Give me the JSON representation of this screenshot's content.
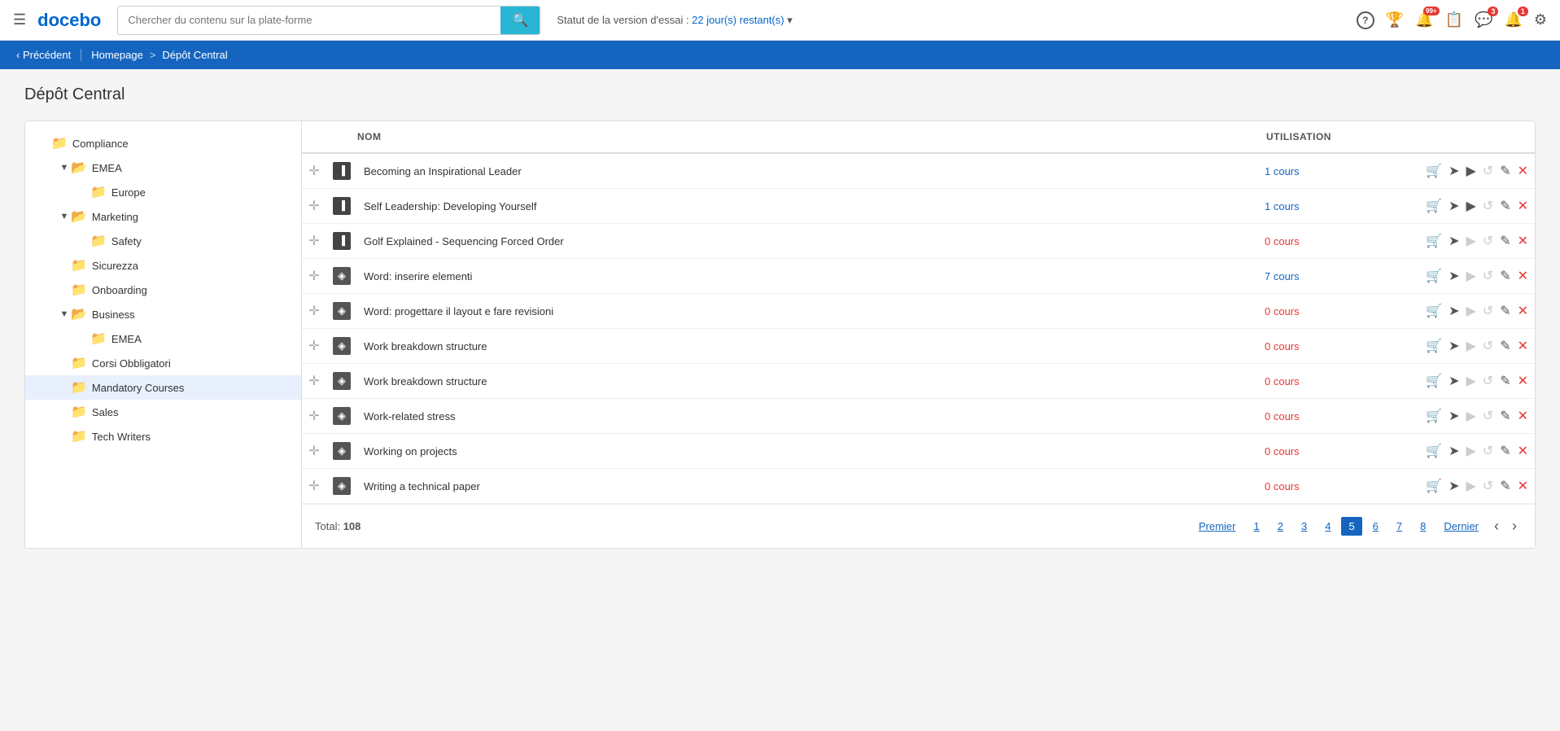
{
  "app": {
    "logo": "docebo",
    "hamburger_label": "☰"
  },
  "search": {
    "placeholder": "Chercher du contenu sur la plate-forme",
    "icon": "🔍"
  },
  "trial": {
    "label": "Statut de la version d'essai : ",
    "days": "22 jour(s) restant(s)",
    "arrow": "▾"
  },
  "nav_icons": [
    {
      "name": "help-icon",
      "symbol": "?",
      "badge": null
    },
    {
      "name": "trophy-icon",
      "symbol": "🏆",
      "badge": null
    },
    {
      "name": "notification-icon",
      "symbol": "🔔",
      "badge": "99+"
    },
    {
      "name": "tasks-icon",
      "symbol": "📋",
      "badge": null
    },
    {
      "name": "chat-icon",
      "symbol": "💬",
      "badge": "3"
    },
    {
      "name": "alerts-icon",
      "symbol": "🔔",
      "badge": "1"
    },
    {
      "name": "settings-icon",
      "symbol": "⚙",
      "badge": null
    }
  ],
  "breadcrumb": {
    "back_label": "‹ Précédent",
    "home": "Homepage",
    "separator": ">",
    "current": "Dépôt Central"
  },
  "page": {
    "title": "Dépôt Central"
  },
  "sidebar": {
    "items": [
      {
        "id": "compliance",
        "label": "Compliance",
        "indent": 1,
        "type": "folder",
        "toggle": "",
        "expanded": false
      },
      {
        "id": "emea",
        "label": "EMEA",
        "indent": 2,
        "type": "folder",
        "toggle": "▼",
        "expanded": true
      },
      {
        "id": "europe",
        "label": "Europe",
        "indent": 3,
        "type": "folder",
        "toggle": "",
        "expanded": false
      },
      {
        "id": "marketing",
        "label": "Marketing",
        "indent": 2,
        "type": "folder",
        "toggle": "▼",
        "expanded": true
      },
      {
        "id": "safety",
        "label": "Safety",
        "indent": 3,
        "type": "folder",
        "toggle": "",
        "expanded": false
      },
      {
        "id": "sicurezza",
        "label": "Sicurezza",
        "indent": 2,
        "type": "folder",
        "toggle": "",
        "expanded": false
      },
      {
        "id": "onboarding",
        "label": "Onboarding",
        "indent": 2,
        "type": "folder",
        "toggle": "",
        "expanded": false
      },
      {
        "id": "business",
        "label": "Business",
        "indent": 2,
        "type": "folder",
        "toggle": "▼",
        "expanded": true
      },
      {
        "id": "emea2",
        "label": "EMEA",
        "indent": 3,
        "type": "folder",
        "toggle": "",
        "expanded": false
      },
      {
        "id": "corsi",
        "label": "Corsi Obbligatori",
        "indent": 2,
        "type": "folder",
        "toggle": "",
        "expanded": false
      },
      {
        "id": "mandatory",
        "label": "Mandatory Courses",
        "indent": 2,
        "type": "folder",
        "toggle": "",
        "expanded": false,
        "active": true
      },
      {
        "id": "sales",
        "label": "Sales",
        "indent": 2,
        "type": "folder",
        "toggle": "",
        "expanded": false
      },
      {
        "id": "techwriters",
        "label": "Tech Writers",
        "indent": 2,
        "type": "folder",
        "toggle": "",
        "expanded": false
      }
    ]
  },
  "table": {
    "col_nom": "NOM",
    "col_usage": "UTILISATION",
    "rows": [
      {
        "name": "Becoming an Inspirational Leader",
        "icon_type": "scorm",
        "icon_symbol": "▐",
        "usage": "1 cours",
        "usage_zero": false,
        "play_active": true
      },
      {
        "name": "Self Leadership: Developing Yourself",
        "icon_type": "scorm",
        "icon_symbol": "▐",
        "usage": "1 cours",
        "usage_zero": false,
        "play_active": true
      },
      {
        "name": "Golf Explained - Sequencing Forced Order",
        "icon_type": "scorm",
        "icon_symbol": "▐",
        "usage": "0 cours",
        "usage_zero": true,
        "play_active": false
      },
      {
        "name": "Word: inserire elementi",
        "icon_type": "elearning",
        "icon_symbol": "◈",
        "usage": "7 cours",
        "usage_zero": false,
        "play_active": false
      },
      {
        "name": "Word: progettare il layout e fare revisioni",
        "icon_type": "elearning",
        "icon_symbol": "◈",
        "usage": "0 cours",
        "usage_zero": true,
        "play_active": false
      },
      {
        "name": "Work breakdown structure",
        "icon_type": "elearning",
        "icon_symbol": "◈",
        "usage": "0 cours",
        "usage_zero": true,
        "play_active": false
      },
      {
        "name": "Work breakdown structure",
        "icon_type": "elearning",
        "icon_symbol": "◈",
        "usage": "0 cours",
        "usage_zero": true,
        "play_active": false
      },
      {
        "name": "Work-related stress",
        "icon_type": "elearning",
        "icon_symbol": "◈",
        "usage": "0 cours",
        "usage_zero": true,
        "play_active": false
      },
      {
        "name": "Working on projects",
        "icon_type": "elearning",
        "icon_symbol": "◈",
        "usage": "0 cours",
        "usage_zero": true,
        "play_active": false
      },
      {
        "name": "Writing a technical paper",
        "icon_type": "elearning",
        "icon_symbol": "◈",
        "usage": "0 cours",
        "usage_zero": true,
        "play_active": false
      }
    ]
  },
  "pagination": {
    "total_label": "Total:",
    "total": "108",
    "first": "Premier",
    "last": "Dernier",
    "pages": [
      "1",
      "2",
      "3",
      "4",
      "5",
      "6",
      "7",
      "8"
    ],
    "current_page": "5",
    "prev": "‹",
    "next": "›"
  }
}
